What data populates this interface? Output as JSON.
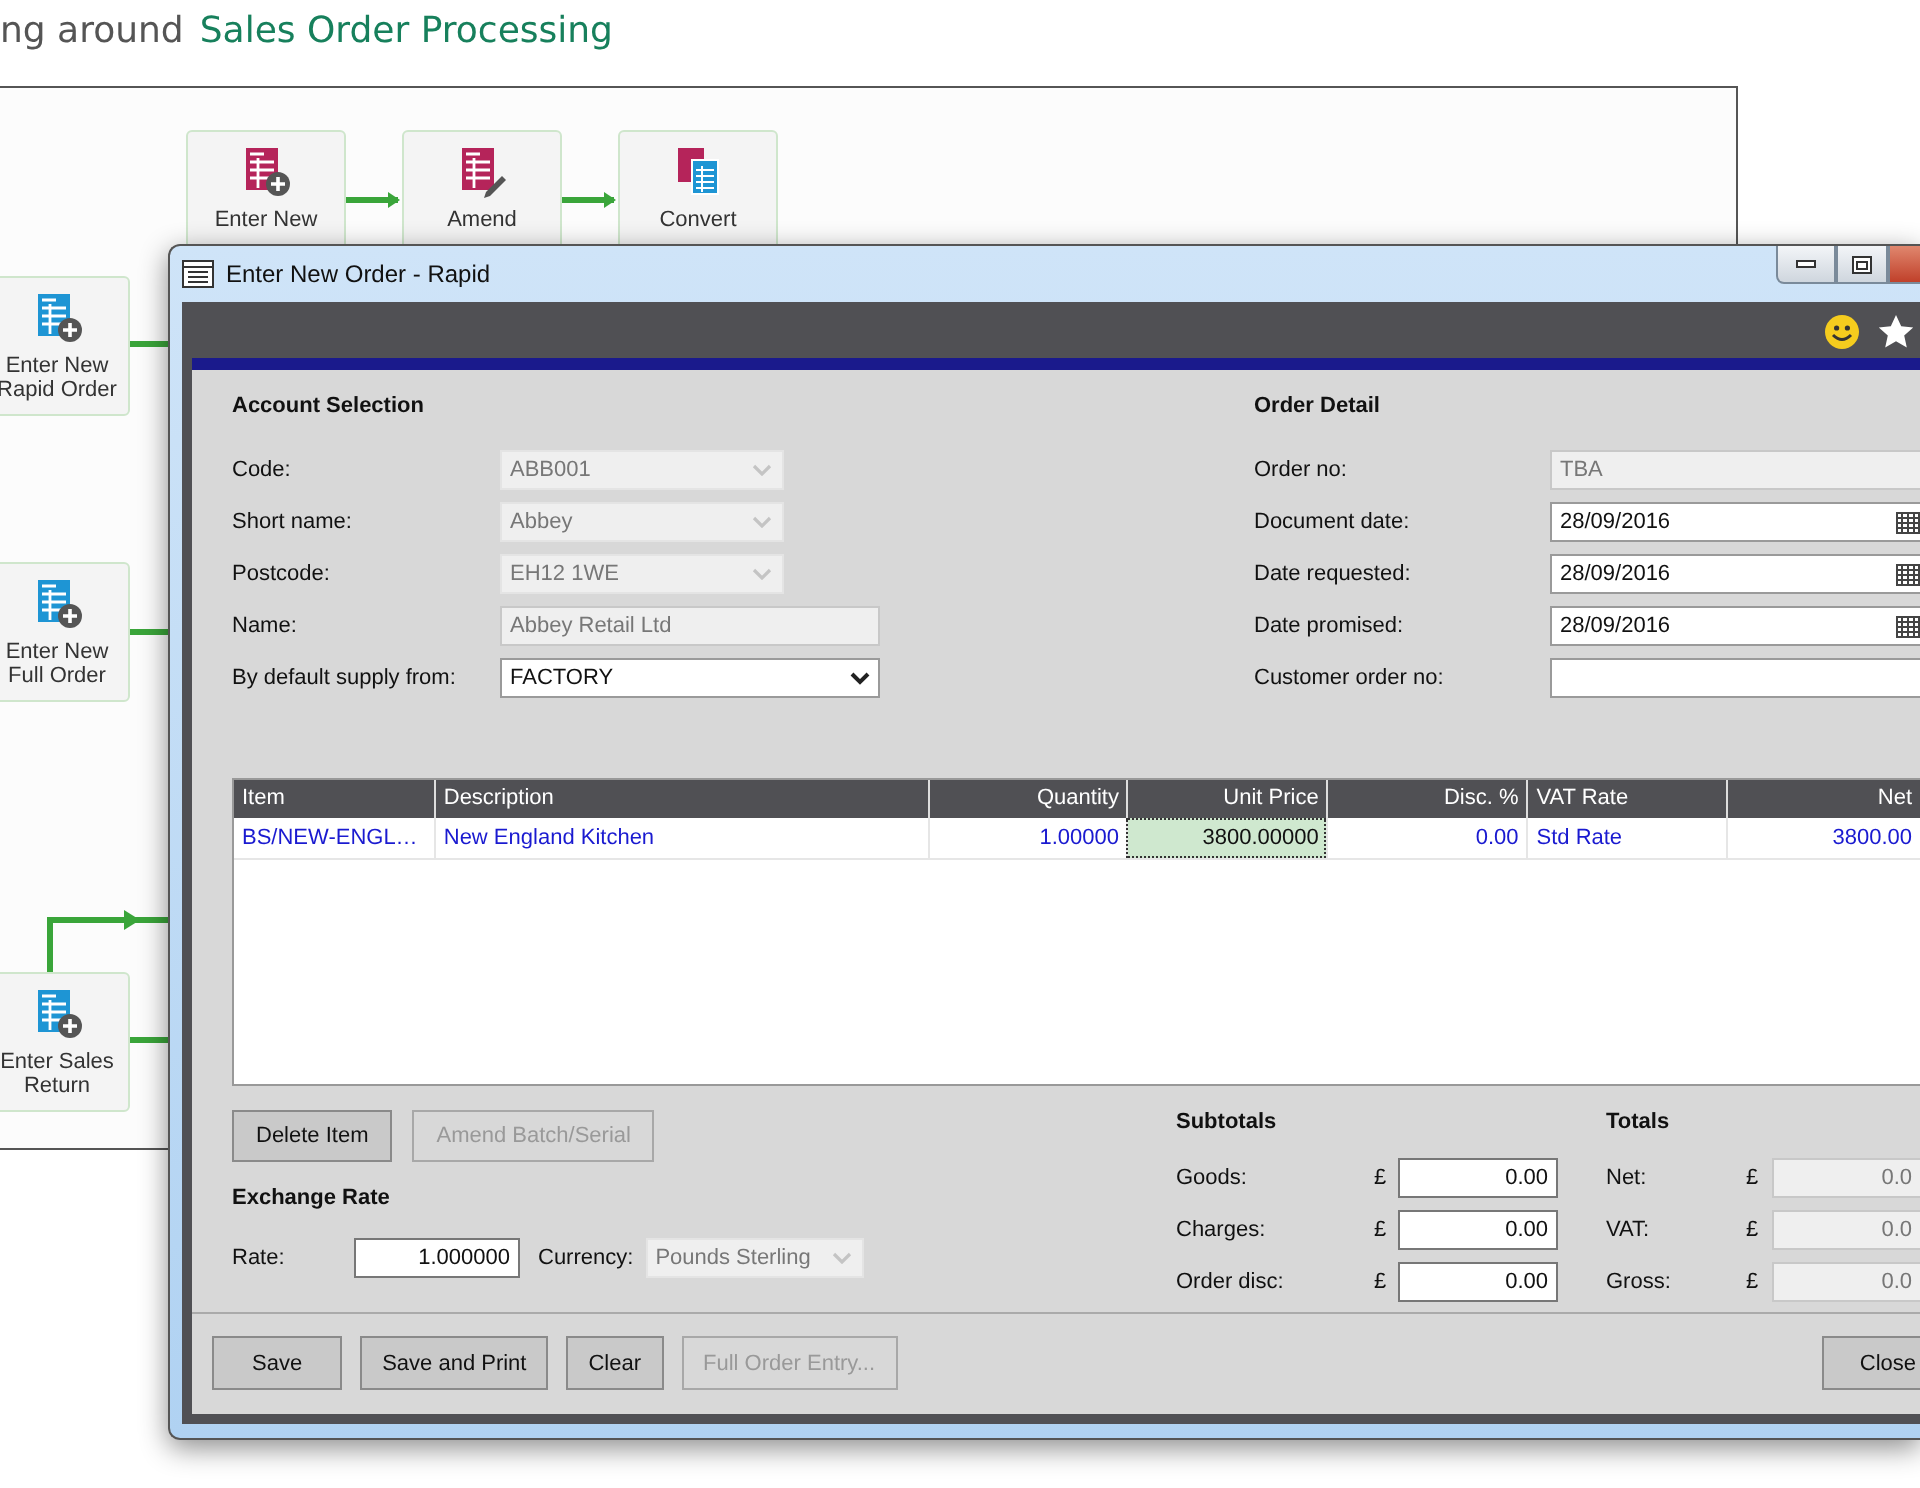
{
  "heading": {
    "prefix": "ng around",
    "title": "Sales Order Processing"
  },
  "flow": {
    "nodes": [
      {
        "kind": "quote_new",
        "lines": [
          "Enter New"
        ]
      },
      {
        "kind": "quote_amend",
        "lines": [
          "Amend"
        ]
      },
      {
        "kind": "quote_convert",
        "lines": [
          "Convert"
        ]
      },
      {
        "kind": "order_new",
        "lines": [
          "Enter New",
          "Rapid Order"
        ]
      },
      {
        "kind": "order_new",
        "lines": [
          "Enter New",
          "Full Order"
        ]
      },
      {
        "kind": "order_new",
        "lines": [
          "Enter Sales",
          "Return"
        ]
      }
    ]
  },
  "dialog": {
    "title": "Enter New Order - Rapid",
    "account_selection": {
      "heading": "Account Selection",
      "fields": [
        {
          "label": "Code:",
          "value": "ABB001",
          "kind": "combo",
          "disabled": true
        },
        {
          "label": "Short name:",
          "value": "Abbey",
          "kind": "combo",
          "disabled": true
        },
        {
          "label": "Postcode:",
          "value": "EH12 1WE",
          "kind": "combo",
          "disabled": true
        },
        {
          "label": "Name:",
          "value": "Abbey Retail Ltd",
          "kind": "text",
          "disabled": true
        },
        {
          "label": "By default supply from:",
          "value": "FACTORY",
          "kind": "select",
          "disabled": false
        }
      ]
    },
    "order_detail": {
      "heading": "Order Detail",
      "fields": [
        {
          "label": "Order no:",
          "value": "TBA",
          "kind": "text",
          "disabled": true
        },
        {
          "label": "Document date:",
          "value": "28/09/2016",
          "kind": "date",
          "disabled": false
        },
        {
          "label": "Date requested:",
          "value": "28/09/2016",
          "kind": "date",
          "disabled": false
        },
        {
          "label": "Date promised:",
          "value": "28/09/2016",
          "kind": "date",
          "disabled": false
        },
        {
          "label": "Customer order no:",
          "kind": "text",
          "disabled": false
        }
      ]
    },
    "table": {
      "columns": [
        {
          "label": "Item"
        },
        {
          "label": "Description"
        },
        {
          "label": "Quantity"
        },
        {
          "label": "Unit Price"
        },
        {
          "label": "Disc. %"
        },
        {
          "label": "VAT Rate"
        },
        {
          "label": "Net"
        }
      ],
      "rows": [
        {
          "cells": [
            {
              "text": "BS/NEW-ENGL…",
              "focused": false
            },
            {
              "text": "New England Kitchen",
              "focused": false
            },
            {
              "text": "1.00000",
              "focused": false
            },
            {
              "text": "3800.00000",
              "focused": true
            },
            {
              "text": "0.00",
              "focused": false
            },
            {
              "text": "Std Rate",
              "focused": false
            },
            {
              "text": "3800.00",
              "focused": false
            }
          ]
        }
      ]
    },
    "item_buttons": [
      {
        "label": "Delete Item",
        "disabled": false
      },
      {
        "label": "Amend Batch/Serial",
        "disabled": true
      }
    ],
    "exchange_rate": {
      "heading": "Exchange Rate",
      "rate_label": "Rate:",
      "rate": "1.000000",
      "currency_label": "Currency:",
      "currency": "Pounds Sterling",
      "currency_disabled": true
    },
    "subtotals": {
      "heading": "Subtotals",
      "rows": [
        {
          "label": "Goods:",
          "currency": "£",
          "value": "0.00",
          "disabled": false
        },
        {
          "label": "Charges:",
          "currency": "£",
          "value": "0.00",
          "disabled": false
        },
        {
          "label": "Order disc:",
          "currency": "£",
          "value": "0.00",
          "disabled": false
        }
      ]
    },
    "totals": {
      "heading": "Totals",
      "rows": [
        {
          "label": "Net:",
          "currency": "£",
          "value": "0.0",
          "disabled": true
        },
        {
          "label": "VAT:",
          "currency": "£",
          "value": "0.0",
          "disabled": true
        },
        {
          "label": "Gross:",
          "currency": "£",
          "value": "0.0",
          "disabled": true
        }
      ]
    },
    "footer_buttons": [
      {
        "label": "Save",
        "disabled": false
      },
      {
        "label": "Save and Print",
        "disabled": false
      },
      {
        "label": "Clear",
        "disabled": false
      },
      {
        "label": "Full Order Entry...",
        "disabled": true
      }
    ],
    "close_button": {
      "label": "Close",
      "disabled": false
    }
  }
}
